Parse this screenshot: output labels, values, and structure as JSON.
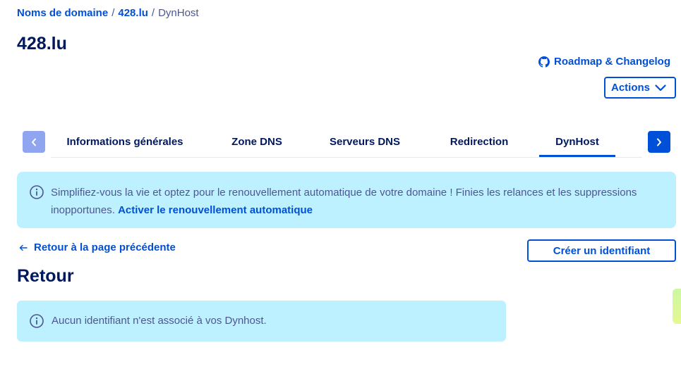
{
  "breadcrumb": {
    "items": [
      {
        "label": "Noms de domaine"
      },
      {
        "label": "428.lu"
      }
    ],
    "current": "DynHost",
    "separator": "/"
  },
  "page": {
    "title": "428.lu"
  },
  "header": {
    "roadmap_label": "Roadmap & Changelog",
    "roadmap_icon": "github-icon",
    "actions_label": "Actions",
    "actions_icon": "chevron-down-icon"
  },
  "tabs": {
    "prev_icon": "chevron-left-icon",
    "next_icon": "chevron-right-icon",
    "items": [
      {
        "label": "Informations générales",
        "active": false
      },
      {
        "label": "Zone DNS",
        "active": false
      },
      {
        "label": "Serveurs DNS",
        "active": false
      },
      {
        "label": "Redirection",
        "active": false
      },
      {
        "label": "DynHost",
        "active": true
      }
    ]
  },
  "banner": {
    "icon": "info-icon",
    "text": "Simplifiez-vous la vie et optez pour le renouvellement automatique de votre domaine ! Finies les relances et les suppressions inopportunes.",
    "link_label": "Activer le renouvellement automatique"
  },
  "back": {
    "label": "Retour à la page précédente",
    "icon": "arrow-left-icon"
  },
  "create_button": {
    "label": "Créer un identifiant"
  },
  "section": {
    "title": "Retour"
  },
  "empty_message": {
    "icon": "info-icon",
    "text": "Aucun identifiant n'est associé à vos Dynhost."
  },
  "colors": {
    "primary": "#0050d7",
    "title": "#00185e",
    "text": "#4d5693",
    "info_bg": "#bef1ff",
    "tab_prev_disabled": "#8fa5ef"
  }
}
